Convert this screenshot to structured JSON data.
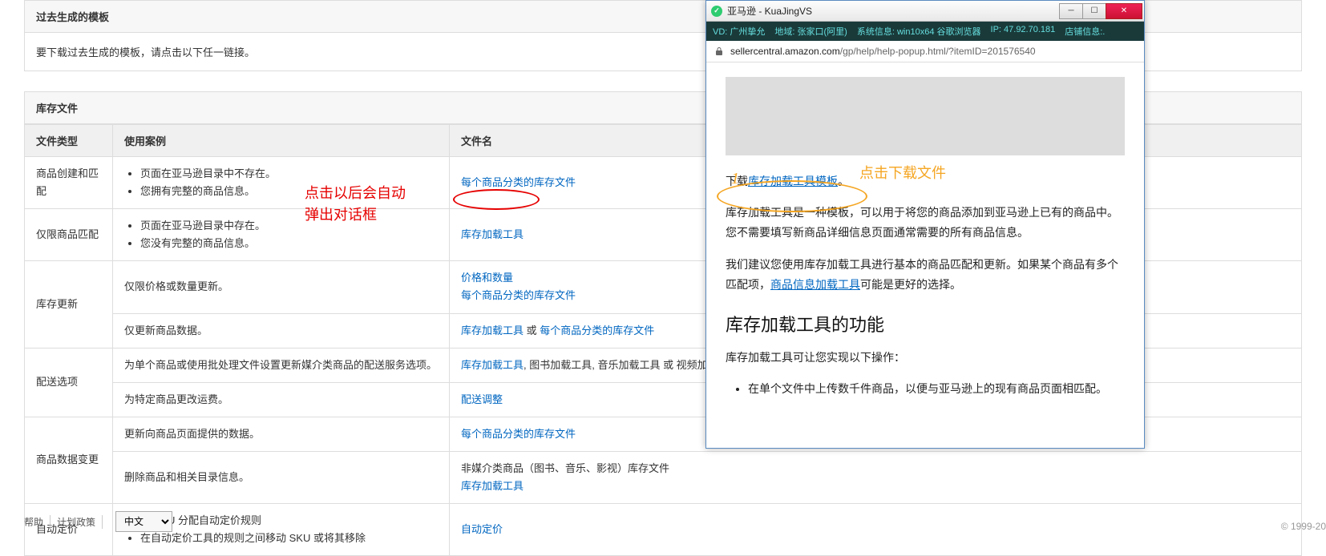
{
  "past_templates": {
    "header": "过去生成的模板",
    "body": "要下载过去生成的模板，请点击以下任一链接。"
  },
  "inv": {
    "header": "库存文件",
    "cols": {
      "type": "文件类型",
      "use": "使用案例",
      "name": "文件名"
    },
    "rows": [
      {
        "type": "商品创建和匹配",
        "uses": [
          "页面在亚马逊目录中不存在。",
          "您拥有完整的商品信息。"
        ],
        "name_html": [
          {
            "t": "link",
            "v": "每个商品分类的库存文件"
          }
        ]
      },
      {
        "type": "仅限商品匹配",
        "uses": [
          "页面在亚马逊目录中存在。",
          "您没有完整的商品信息。"
        ],
        "name_html": [
          {
            "t": "link",
            "v": "库存加载工具"
          }
        ]
      },
      {
        "type": "库存更新",
        "sub": [
          {
            "use": "仅限价格或数量更新。",
            "name": [
              {
                "t": "link",
                "v": "价格和数量"
              },
              {
                "t": "br"
              },
              {
                "t": "link",
                "v": "每个商品分类的库存文件"
              }
            ]
          },
          {
            "use": "仅更新商品数据。",
            "name": [
              {
                "t": "link",
                "v": "库存加载工具"
              },
              {
                "t": "text",
                "v": " 或 "
              },
              {
                "t": "link",
                "v": "每个商品分类的库存文件"
              }
            ]
          }
        ]
      },
      {
        "type": "配送选项",
        "sub": [
          {
            "use": "为单个商品或使用批处理文件设置更新媒介类商品的配送服务选项。",
            "name": [
              {
                "t": "link",
                "v": "库存加载工具"
              },
              {
                "t": "text",
                "v": ", 图书加载工具, 音乐加载工具 或 视频加"
              }
            ]
          },
          {
            "use": "为特定商品更改运费。",
            "name": [
              {
                "t": "link",
                "v": "配送调整"
              }
            ]
          }
        ]
      },
      {
        "type": "商品数据变更",
        "sub": [
          {
            "use": "更新向商品页面提供的数据。",
            "name": [
              {
                "t": "link",
                "v": "每个商品分类的库存文件"
              }
            ]
          },
          {
            "use": "删除商品和相关目录信息。",
            "name": [
              {
                "t": "text",
                "v": "非媒介类商品（图书、音乐、影视）库存文件"
              },
              {
                "t": "br"
              },
              {
                "t": "link",
                "v": "库存加载工具"
              }
            ]
          }
        ]
      },
      {
        "type": "自动定价",
        "uses": [
          "为 SKU 分配自动定价规则",
          "在自动定价工具的规则之间移动 SKU 或将其移除"
        ],
        "name_html": [
          {
            "t": "link",
            "v": "自动定价"
          }
        ]
      }
    ]
  },
  "annotations": {
    "red_line1": "点击以后会自动",
    "red_line2": "弹出对话框",
    "orange_title": "点击下载文件",
    "num1": "1"
  },
  "popup": {
    "title": "亚马逊 - KuaJingVS",
    "info": {
      "vd": "VD: 广州挚允",
      "region": "地域: 张家口(阿里)",
      "sys": "系统信息: win10x64  谷歌浏览器",
      "ip": "IP: 47.92.70.181",
      "shop": "店铺信息:."
    },
    "url_domain": "sellercentral.amazon.com",
    "url_path": "/gp/help/help-popup.html/?itemID=201576540",
    "p1_prefix": "下载",
    "p1_link": "库存加载工具模板",
    "p1_suffix": "。",
    "p2": "库存加载工具是一种模板，可以用于将您的商品添加到亚马逊上已有的商品中。您不需要填写新商品详细信息页面通常需要的所有商品信息。",
    "p3a": "我们建议您使用库存加载工具进行基本的商品匹配和更新。如果某个商品有多个匹配项，",
    "p3_link": "商品信息加载工具",
    "p3b": "可能是更好的选择。",
    "h2": "库存加载工具的功能",
    "p4": "库存加载工具可让您实现以下操作：",
    "li1": "在单个文件中上传数千件商品，以便与亚马逊上的现有商品页面相匹配。"
  },
  "footer": {
    "help": "帮助",
    "plan": "计划政策",
    "lang": "中文",
    "copyright": "© 1999-20"
  }
}
